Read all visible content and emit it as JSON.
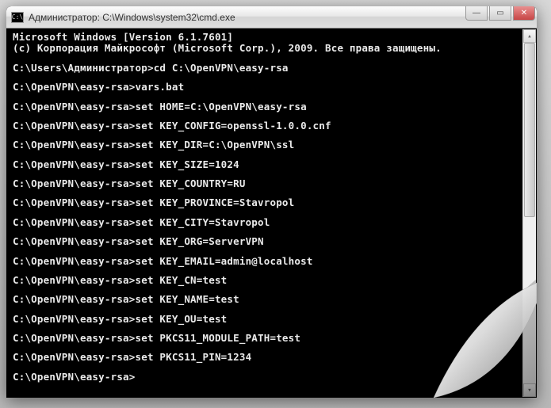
{
  "window": {
    "title": "Администратор: C:\\Windows\\system32\\cmd.exe",
    "icon_label": "C:\\"
  },
  "terminal": {
    "banner1": "Microsoft Windows [Version 6.1.7601]",
    "banner2": "(c) Корпорация Майкрософт (Microsoft Corp.), 2009. Все права защищены.",
    "lines": [
      "C:\\Users\\Администратор>cd C:\\OpenVPN\\easy-rsa",
      "C:\\OpenVPN\\easy-rsa>vars.bat",
      "C:\\OpenVPN\\easy-rsa>set HOME=C:\\OpenVPN\\easy-rsa",
      "C:\\OpenVPN\\easy-rsa>set KEY_CONFIG=openssl-1.0.0.cnf",
      "C:\\OpenVPN\\easy-rsa>set KEY_DIR=C:\\OpenVPN\\ssl",
      "C:\\OpenVPN\\easy-rsa>set KEY_SIZE=1024",
      "C:\\OpenVPN\\easy-rsa>set KEY_COUNTRY=RU",
      "C:\\OpenVPN\\easy-rsa>set KEY_PROVINCE=Stavropol",
      "C:\\OpenVPN\\easy-rsa>set KEY_CITY=Stavropol",
      "C:\\OpenVPN\\easy-rsa>set KEY_ORG=ServerVPN",
      "C:\\OpenVPN\\easy-rsa>set KEY_EMAIL=admin@localhost",
      "C:\\OpenVPN\\easy-rsa>set KEY_CN=test",
      "C:\\OpenVPN\\easy-rsa>set KEY_NAME=test",
      "C:\\OpenVPN\\easy-rsa>set KEY_OU=test",
      "C:\\OpenVPN\\easy-rsa>set PKCS11_MODULE_PATH=test",
      "C:\\OpenVPN\\easy-rsa>set PKCS11_PIN=1234",
      "C:\\OpenVPN\\easy-rsa>"
    ]
  },
  "controls": {
    "minimize": "—",
    "maximize": "▭",
    "close": "✕",
    "scroll_up": "▴",
    "scroll_down": "▾"
  }
}
